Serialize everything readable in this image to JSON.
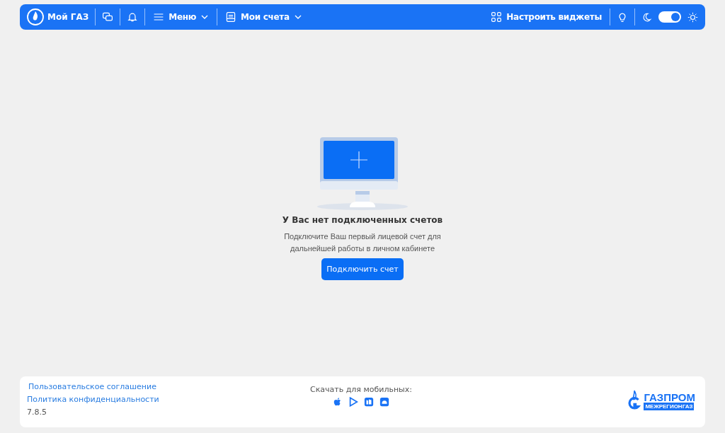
{
  "header": {
    "brand": "Мой ГАЗ",
    "menu": "Меню",
    "accounts": "Мои счета",
    "widgets": "Настроить виджеты",
    "theme_toggle": {
      "on": true
    }
  },
  "empty_state": {
    "title": "У Вас нет подключенных счетов",
    "text": "Подключите Ваш первый лицевой счет для дальнейшей работы в личном кабинете",
    "button": "Подключить счет"
  },
  "footer": {
    "links": [
      "Пользовательское соглашение",
      "Политика конфиденциальности"
    ],
    "version": "7.8.5",
    "download_label": "Скачать для мобильных:",
    "logo": {
      "name": "ГАЗПРОМ",
      "sub": "МЕЖРЕГИОНГАЗ"
    }
  }
}
